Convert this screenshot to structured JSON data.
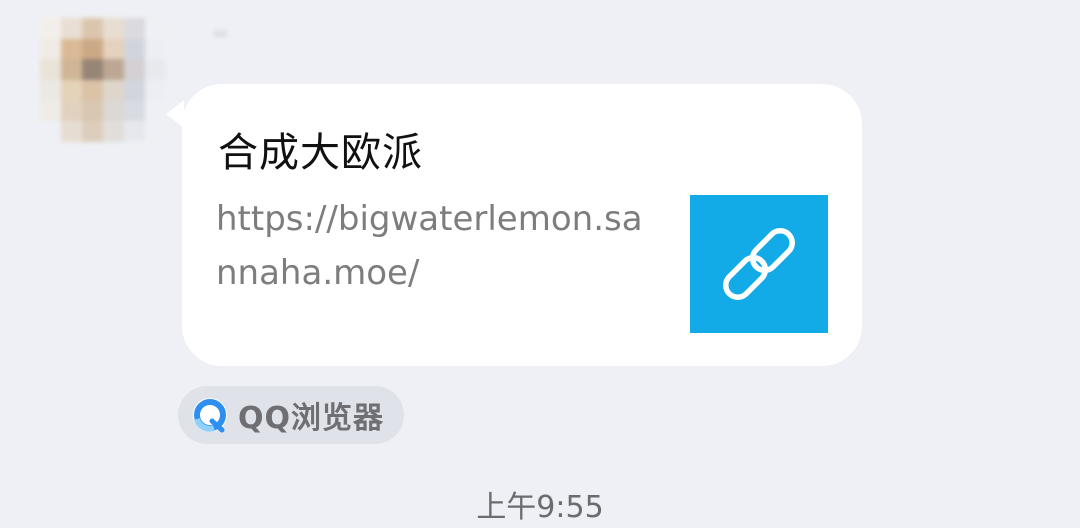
{
  "chat": {
    "card": {
      "title": "合成大欧派",
      "url": "https://bigwaterlemon.sannaha.moe/",
      "thumbnail_icon": "link-icon",
      "thumbnail_color": "#12abe8"
    },
    "source": {
      "label": "QQ浏览器",
      "icon": "qq-browser-icon"
    },
    "timestamp": "上午9:55"
  },
  "colors": {
    "background": "#eef0f5",
    "bubble": "#ffffff",
    "accent": "#12abe8"
  }
}
